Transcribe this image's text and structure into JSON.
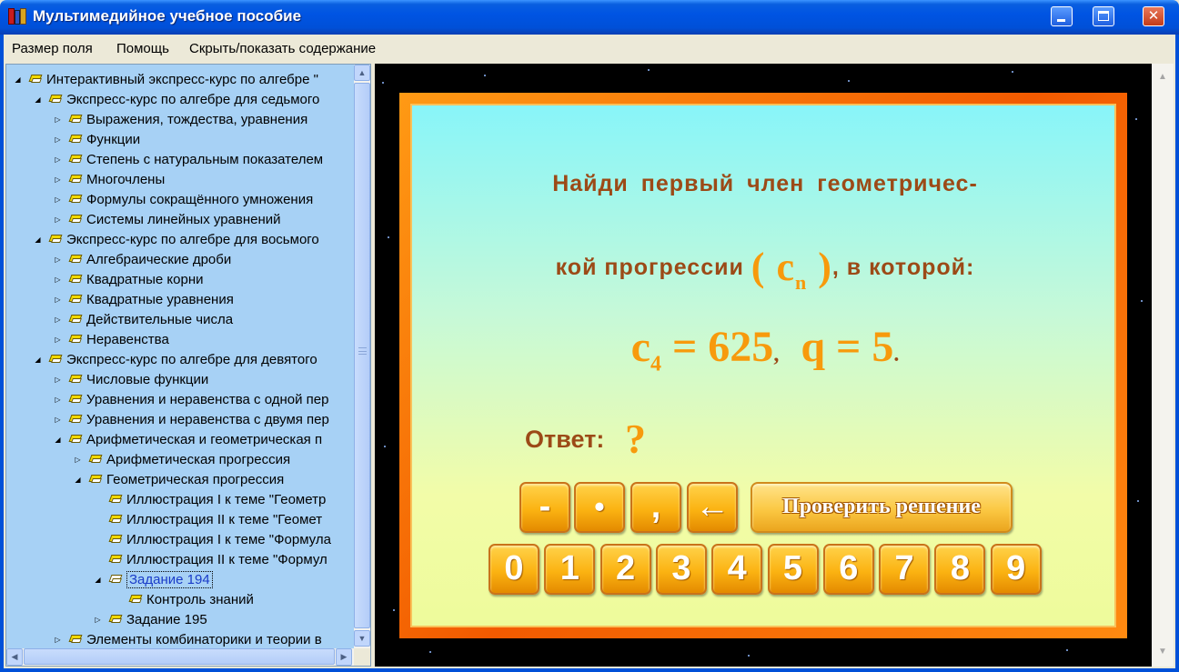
{
  "window": {
    "title": "Мультимедийное учебное пособие",
    "buttons": {
      "minimize": "",
      "maximize": "",
      "close": "✕"
    }
  },
  "menu": [
    {
      "label": "Размер поля"
    },
    {
      "label": "Помощь"
    },
    {
      "label": "Скрыть/показать содержание"
    }
  ],
  "tree": [
    {
      "label": "Интерактивный экспресс-курс по алгебре \"",
      "level": 0,
      "expanded": true
    },
    {
      "label": "Экспресс-курс по алгебре для седьмого",
      "level": 1,
      "expanded": true
    },
    {
      "label": "Выражения, тождества, уравнения",
      "level": 2,
      "expanded": false
    },
    {
      "label": "Функции",
      "level": 2,
      "expanded": false
    },
    {
      "label": "Степень с натуральным показателем",
      "level": 2,
      "expanded": false
    },
    {
      "label": "Многочлены",
      "level": 2,
      "expanded": false
    },
    {
      "label": "Формулы сокращённого умножения",
      "level": 2,
      "expanded": false
    },
    {
      "label": "Системы линейных уравнений",
      "level": 2,
      "expanded": false
    },
    {
      "label": "Экспресс-курс по алгебре для восьмого",
      "level": 1,
      "expanded": true
    },
    {
      "label": "Алгебраические дроби",
      "level": 2,
      "expanded": false
    },
    {
      "label": "Квадратные корни",
      "level": 2,
      "expanded": false
    },
    {
      "label": "Квадратные уравнения",
      "level": 2,
      "expanded": false
    },
    {
      "label": "Действительные числа",
      "level": 2,
      "expanded": false
    },
    {
      "label": "Неравенства",
      "level": 2,
      "expanded": false
    },
    {
      "label": "Экспресс-курс по алгебре для девятого",
      "level": 1,
      "expanded": true
    },
    {
      "label": "Числовые функции",
      "level": 2,
      "expanded": false
    },
    {
      "label": "Уравнения и неравенства с одной пер",
      "level": 2,
      "expanded": false
    },
    {
      "label": "Уравнения и неравенства с двумя пер",
      "level": 2,
      "expanded": false
    },
    {
      "label": "Арифметическая и геометрическая п",
      "level": 2,
      "expanded": true
    },
    {
      "label": "Арифметическая прогрессия",
      "level": 3,
      "expanded": false
    },
    {
      "label": "Геометрическая прогрессия",
      "level": 3,
      "expanded": true
    },
    {
      "label": "Иллюстрация I к теме \"Геометр",
      "level": 4,
      "leaf": true
    },
    {
      "label": "Иллюстрация II к теме \"Геомет",
      "level": 4,
      "leaf": true
    },
    {
      "label": "Иллюстрация I к теме \"Формула",
      "level": 4,
      "leaf": true
    },
    {
      "label": "Иллюстрация II к теме \"Формул",
      "level": 4,
      "leaf": true
    },
    {
      "label": "Задание 194",
      "level": 4,
      "expanded": true,
      "selected": true
    },
    {
      "label": "Контроль знаний",
      "level": 5,
      "leaf": true
    },
    {
      "label": "Задание 195",
      "level": 4,
      "expanded": false
    },
    {
      "label": "Элементы комбинаторики и теории в",
      "level": 2,
      "expanded": false
    }
  ],
  "task": {
    "line1": [
      "Найди",
      "первый",
      "член",
      "геометричес-"
    ],
    "line2_before": "кой прогрессии",
    "seq_open": "(",
    "seq_letter": "c",
    "seq_sub": "n",
    "seq_close": ")",
    "line2_after": ", в которой:",
    "formula": {
      "c_letter": "c",
      "c_sub": "4",
      "c_value": " = 625",
      "sep": ",",
      "q_part": "q = 5",
      "end": "."
    },
    "answer_label": "Ответ:",
    "answer_value": "?"
  },
  "keypad": {
    "symbols": [
      "-",
      "•",
      ",",
      "←"
    ],
    "check_label": "Проверить решение",
    "digits": [
      "0",
      "1",
      "2",
      "3",
      "4",
      "5",
      "6",
      "7",
      "8",
      "9"
    ]
  },
  "colors": {
    "title_bar": "#0054e3",
    "tree_bg": "#a7d1f5",
    "frame_orange": "#f25a00",
    "text_brown": "#9c4a17",
    "accent_orange": "#f79a0c"
  }
}
